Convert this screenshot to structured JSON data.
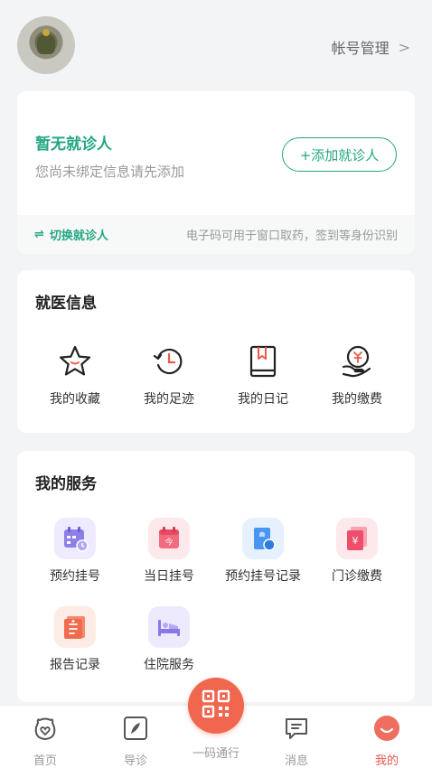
{
  "header": {
    "account_label": "帐号管理",
    "chevron": ">"
  },
  "patient": {
    "title": "暂无就诊人",
    "subtitle": "您尚未绑定信息请先添加",
    "add_button": "+添加就诊人",
    "switch_label": "切换就诊人",
    "switch_icon": "⇌",
    "note": "电子码可用于窗口取药，签到等身份识别"
  },
  "medical_info": {
    "title": "就医信息",
    "items": [
      {
        "label": "我的收藏",
        "icon": "star-icon"
      },
      {
        "label": "我的足迹",
        "icon": "history-clock-icon"
      },
      {
        "label": "我的日记",
        "icon": "bookmark-book-icon"
      },
      {
        "label": "我的缴费",
        "icon": "yuan-hand-icon"
      }
    ]
  },
  "services": {
    "title": "我的服务",
    "items": [
      {
        "label": "预约挂号",
        "icon": "calendar-clock-icon",
        "color": "#7b6fe0"
      },
      {
        "label": "当日挂号",
        "icon": "calendar-today-icon",
        "color": "#ef5a6f"
      },
      {
        "label": "预约挂号记录",
        "icon": "document-record-icon",
        "color": "#3f8ef0"
      },
      {
        "label": "门诊缴费",
        "icon": "yuan-document-icon",
        "color": "#ef4d6a"
      },
      {
        "label": "报告记录",
        "icon": "report-icon",
        "color": "#f06a4e"
      },
      {
        "label": "住院服务",
        "icon": "hospital-bed-icon",
        "color": "#8a78e6"
      }
    ]
  },
  "tabbar": {
    "items": [
      {
        "label": "首页",
        "icon": "home-icon",
        "active": false
      },
      {
        "label": "导诊",
        "icon": "compass-icon",
        "active": false
      },
      {
        "label": "一码通行",
        "icon": "qr-code-icon",
        "active": false
      },
      {
        "label": "消息",
        "icon": "message-icon",
        "active": false
      },
      {
        "label": "我的",
        "icon": "profile-smile-icon",
        "active": true
      }
    ],
    "accent": "#e8594a"
  },
  "colors": {
    "brand_green": "#23a683",
    "accent_red": "#f0664f"
  }
}
